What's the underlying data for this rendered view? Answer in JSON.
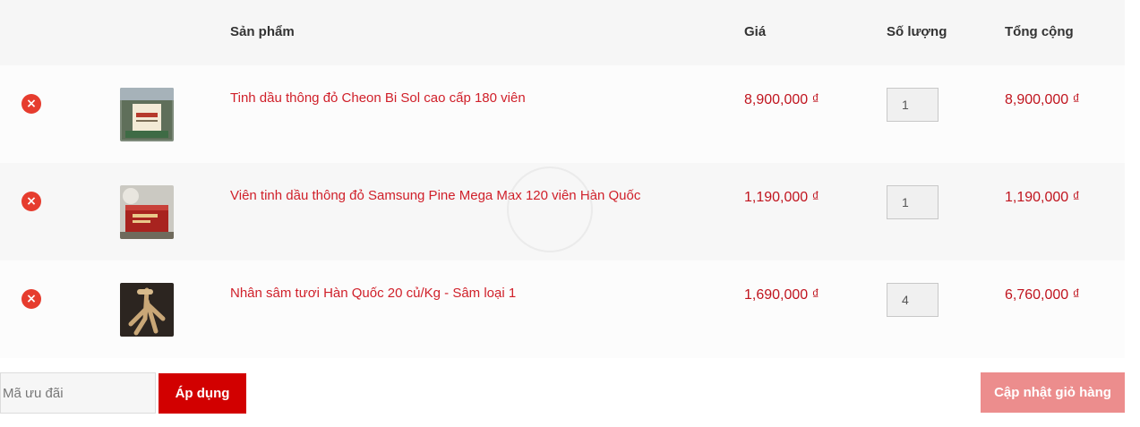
{
  "table_header": {
    "product": "Sản phẩm",
    "price": "Giá",
    "quantity": "Số lượng",
    "total": "Tổng cộng"
  },
  "items": [
    {
      "name": "Tinh dầu thông đỏ Cheon Bi Sol cao cấp 180 viên",
      "price": "8,900,000 ₫",
      "quantity": "1",
      "total": "8,900,000 ₫"
    },
    {
      "name": "Viên tinh dầu thông đỏ Samsung Pine Mega Max 120 viên Hàn Quốc",
      "price": "1,190,000 ₫",
      "quantity": "1",
      "total": "1,190,000 ₫"
    },
    {
      "name": "Nhân sâm tươi Hàn Quốc 20 củ/Kg - Sâm loại 1",
      "price": "1,690,000 ₫",
      "quantity": "4",
      "total": "6,760,000 ₫"
    }
  ],
  "remove_icon": "×",
  "coupon": {
    "placeholder": "Mã ưu đãi"
  },
  "apply_label": "Áp dụng",
  "update_label": "Cập nhật giỏ hàng",
  "colors": {
    "accent": "#d20000",
    "price": "#c0141e",
    "update_button": "#ec8d8d"
  }
}
